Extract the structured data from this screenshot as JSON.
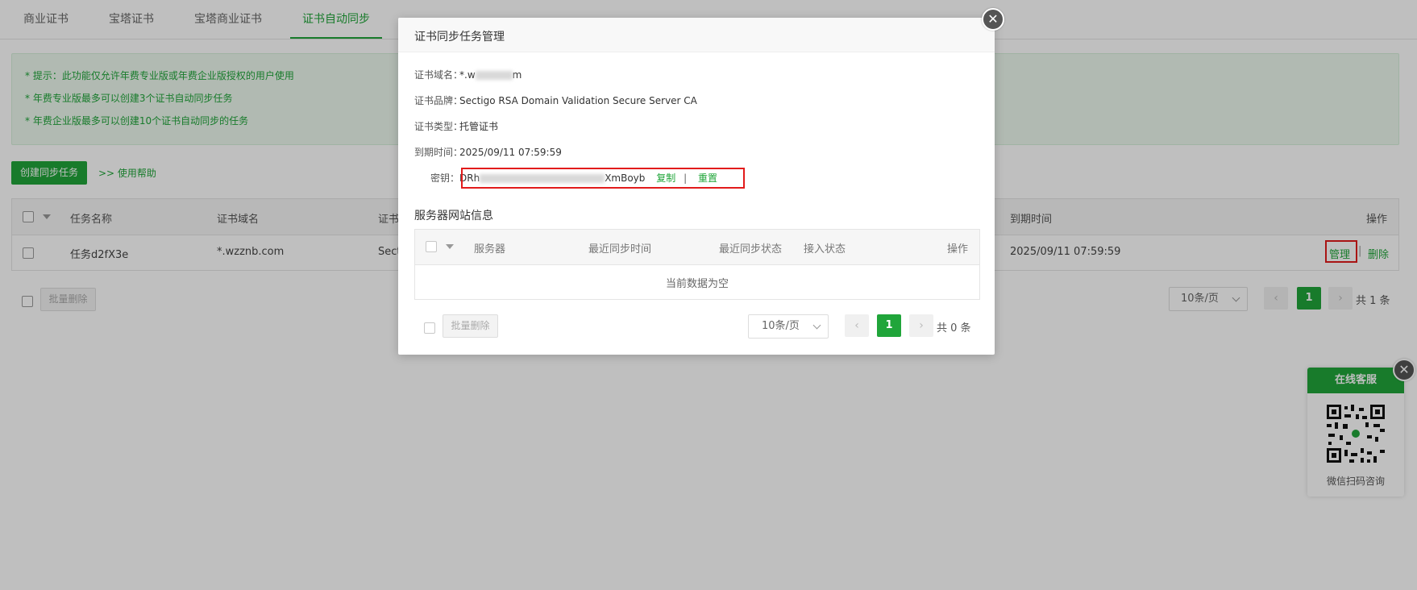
{
  "tabs": [
    {
      "label": "商业证书",
      "active": false
    },
    {
      "label": "宝塔证书",
      "active": false
    },
    {
      "label": "宝塔商业证书",
      "active": false
    },
    {
      "label": "证书自动同步",
      "active": true
    }
  ],
  "notice": {
    "lines": [
      "* 提示：此功能仅允许年费专业版或年费企业版授权的用户使用",
      "* 年费专业版最多可以创建3个证书自动同步任务",
      "* 年费企业版最多可以创建10个证书自动同步的任务"
    ]
  },
  "toolbar": {
    "create_label": "创建同步任务",
    "help_label": ">> 使用帮助"
  },
  "task_table": {
    "columns": [
      "任务名称",
      "证书域名",
      "证书",
      "到期时间",
      "操作"
    ],
    "rows": [
      {
        "name": "任务d2fX3e",
        "domain": "*.wzznb.com",
        "cert_partial": "Sect",
        "expire": "2025/09/11 07:59:59",
        "manage": "管理",
        "sep": "|",
        "delete": "删除"
      }
    ]
  },
  "footer": {
    "batch_delete": "批量删除",
    "page_size": "10条/页",
    "current_page": "1",
    "total": "共 1 条"
  },
  "modal": {
    "title": "证书同步任务管理",
    "close_glyph": "✕",
    "fields": {
      "domain_label": "证书域名：",
      "domain_prefix": "*.w",
      "domain_suffix": "m",
      "brand_label": "证书品牌：",
      "brand_value": "Sectigo RSA Domain Validation Secure Server CA",
      "type_label": "证书类型：",
      "type_value": "托管证书",
      "expire_label": "到期时间：",
      "expire_value": "2025/09/11 07:59:59",
      "key_label": "密钥：",
      "key_prefix": "DRh",
      "key_suffix": "XmBoyb",
      "copy": "复制",
      "sep": "|",
      "reset": "重置"
    },
    "server_section": {
      "title": "服务器网站信息",
      "columns": [
        "服务器",
        "最近同步时间",
        "最近同步状态",
        "接入状态",
        "操作"
      ],
      "empty": "当前数据为空"
    },
    "footer": {
      "batch_delete": "批量删除",
      "page_size": "10条/页",
      "current_page": "1",
      "total": "共 0 条"
    }
  },
  "support": {
    "title": "在线客服",
    "caption": "微信扫码咨询",
    "close_glyph": "✕"
  },
  "colors": {
    "accent": "#20a53a",
    "highlight": "#e21b1b"
  }
}
